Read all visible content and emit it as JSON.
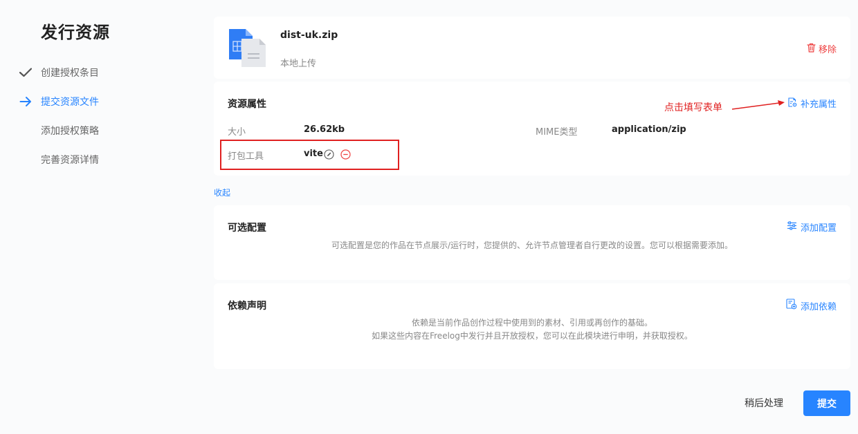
{
  "sidebar": {
    "title": "发行资源",
    "steps": [
      {
        "label": "创建授权条目",
        "state": "done",
        "icon": "check-icon"
      },
      {
        "label": "提交资源文件",
        "state": "active",
        "icon": "arrow-right-icon"
      },
      {
        "label": "添加授权策略",
        "state": "pending"
      },
      {
        "label": "完善资源详情",
        "state": "pending"
      }
    ]
  },
  "file": {
    "name": "dist-uk.zip",
    "source": "本地上传",
    "remove_label": "移除",
    "icon": "zip-file-icon"
  },
  "attributes": {
    "title": "资源属性",
    "action_label": "补充属性",
    "annotation": "点击填写表单",
    "items": [
      {
        "key": "大小",
        "value": "26.62kb"
      },
      {
        "key": "MIME类型",
        "value": "application/zip"
      },
      {
        "key": "打包工具",
        "value": "vite"
      }
    ],
    "collapse_label": "收起"
  },
  "optional": {
    "title": "可选配置",
    "action_label": "添加配置",
    "description": "可选配置是您的作品在节点展示/运行时，您提供的、允许节点管理者自行更改的设置。您可以根据需要添加。"
  },
  "dependency": {
    "title": "依赖声明",
    "action_label": "添加依赖",
    "description_1": "依赖是当前作品创作过程中使用到的素材、引用或再创作的基础。",
    "description_2": "如果这些内容在Freelog中发行并且开放授权，您可以在此模块进行申明，并获取授权。"
  },
  "footer": {
    "later_label": "稍后处理",
    "submit_label": "提交"
  },
  "colors": {
    "primary": "#2784ff",
    "danger": "#ee4040",
    "annotation": "#e02020"
  }
}
